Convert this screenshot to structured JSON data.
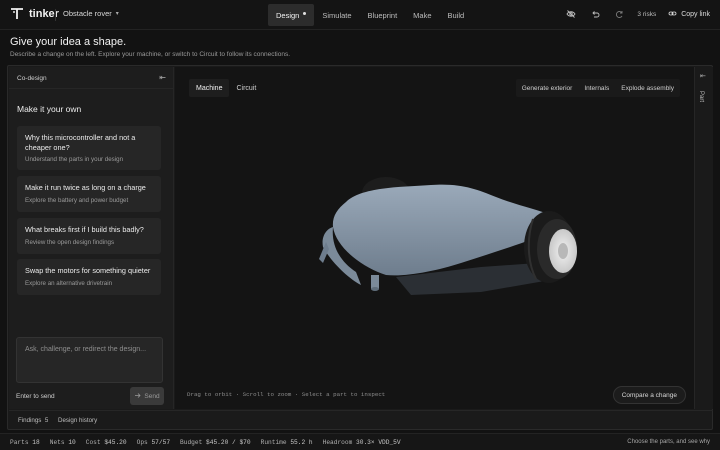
{
  "app": {
    "brand": "tinker",
    "project": "Obstacle rover"
  },
  "nav": {
    "tabs": [
      "Design",
      "Simulate",
      "Blueprint",
      "Make",
      "Build"
    ],
    "active": "Design"
  },
  "toolbar": {
    "risks": "3 risks",
    "copy_link": "Copy link"
  },
  "intro": {
    "title": "Give your idea a shape.",
    "subtitle": "Describe a change on the left. Explore your machine, or switch to Circuit to follow its connections."
  },
  "codesign": {
    "title": "Co-design",
    "section_title": "Make it your own",
    "cards": [
      {
        "question": "Why this microcontroller and not a cheaper one?",
        "detail": "Understand the parts in your design"
      },
      {
        "question": "Make it run twice as long on a charge",
        "detail": "Explore the battery and power budget"
      },
      {
        "question": "What breaks first if I build this badly?",
        "detail": "Review the open design findings"
      },
      {
        "question": "Swap the motors for something quieter",
        "detail": "Explore an alternative drivetrain"
      }
    ],
    "input_placeholder": "Ask, challenge, or redirect the design...",
    "enter_hint": "Enter to send",
    "send_label": "Send"
  },
  "footer_tabs": {
    "findings_label": "Findings",
    "findings_count": "5",
    "history_label": "Design history"
  },
  "viewport": {
    "view_tabs": [
      "Machine",
      "Circuit"
    ],
    "active_view": "Machine",
    "tools": [
      "Generate exterior",
      "Internals",
      "Explode assembly"
    ],
    "hint": "Drag to orbit · Scroll to zoom · Select a part to inspect",
    "compare_label": "Compare a change"
  },
  "rail": {
    "label": "Part"
  },
  "status": {
    "parts_label": "Parts",
    "parts": "18",
    "nets_label": "Nets",
    "nets": "10",
    "cost_label": "Cost",
    "cost": "$45.20",
    "ops_label": "Ops",
    "ops": "57/57",
    "budget_label": "Budget",
    "budget": "$45.20 / $70",
    "runtime_label": "Runtime",
    "runtime": "55.2 h",
    "headroom_label": "Headroom",
    "headroom": "30.3× VDD_5V",
    "right_text": "Choose the parts, and see why"
  },
  "icons": {
    "logo": "tinker-logo-icon",
    "project_dropdown": "chevron-down-icon",
    "visibility": "eye-off-icon",
    "undo": "undo-icon",
    "redo": "redo-icon",
    "link": "link-icon",
    "collapse": "collapse-panel-icon",
    "send": "send-icon",
    "rail_expand": "expand-panel-icon"
  },
  "colors": {
    "background": "#121212",
    "panel": "#1d1d1d",
    "card": "#262626",
    "rover_body": "#7e8ea0",
    "accent_yellow": "#e4d27a"
  }
}
